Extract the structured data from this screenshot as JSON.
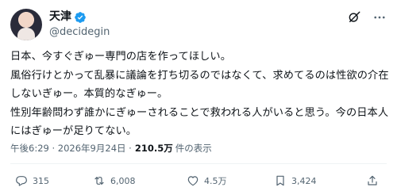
{
  "user": {
    "display_name": "天津",
    "handle": "@decidegin",
    "verified": true,
    "avatar": "anime-girl-avatar"
  },
  "header_icons": [
    "grok-icon",
    "more-icon"
  ],
  "post": {
    "text": "日本、今すぐぎゅー専門の店を作ってほしい。\n風俗行けとかって乱暴に議論を打ち切るのではなくて、求めてるのは性欲の介在しないぎゅー。本質的なぎゅー。\n性別年齢問わず誰かにぎゅーされることで救われる人がいると思う。今の日本人にはぎゅーが足りてない。",
    "time": "午後6:29 · 2026年9月24日 ·",
    "views_count": "210.5万",
    "views_label": "件の表示"
  },
  "actions": {
    "replies": "315",
    "retweets": "6,008",
    "likes": "4.5万",
    "bookmarks": "3,424"
  },
  "colors": {
    "text": "#0f1419",
    "secondary": "#536471",
    "verified": "#1d9bf0",
    "divider": "#eff3f4"
  }
}
